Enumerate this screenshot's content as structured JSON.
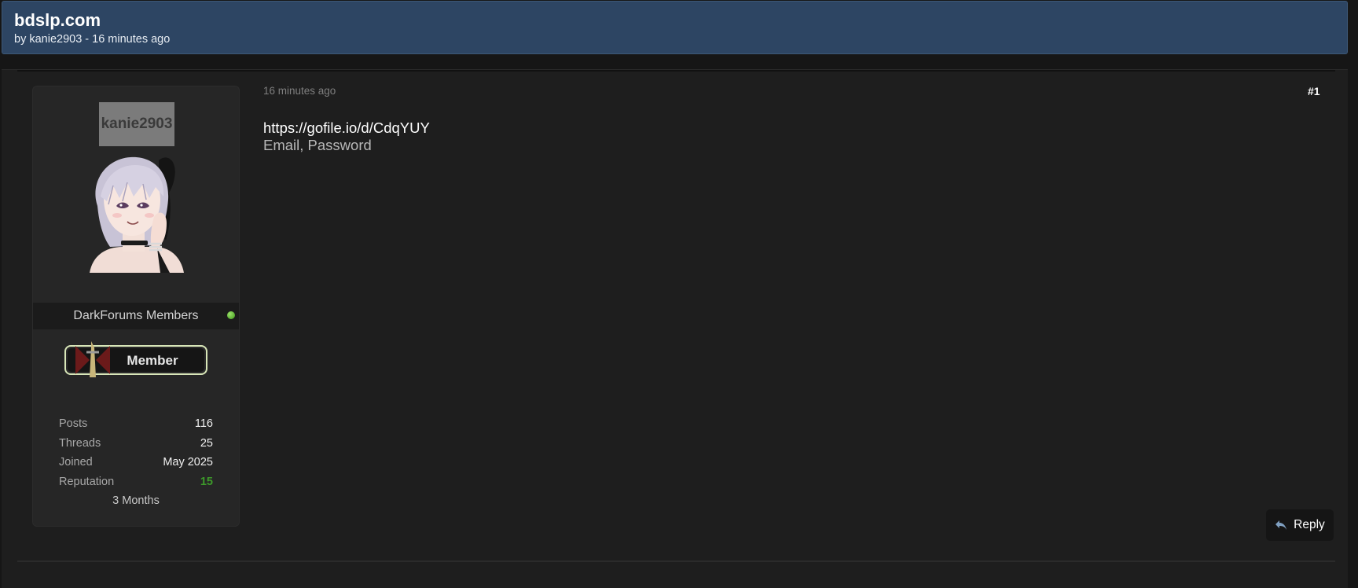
{
  "thread": {
    "title": "bdslp.com",
    "meta": "by kanie2903 - 16 minutes ago"
  },
  "user": {
    "name": "kanie2903",
    "group": "DarkForums Members",
    "rank_badge_text": "Member",
    "stats": [
      {
        "label": "Posts",
        "value": "116"
      },
      {
        "label": "Threads",
        "value": "25"
      },
      {
        "label": "Joined",
        "value": "May 2025"
      },
      {
        "label": "Reputation",
        "value": "15"
      }
    ],
    "duration": "3 Months",
    "online_color": "#5cc02c"
  },
  "post": {
    "time": "16 minutes ago",
    "number": "#1",
    "link": "https://gofile.io/d/CdqYUY",
    "line2": "Email, Password"
  },
  "actions": {
    "reply_label": "Reply",
    "reply_icon": "reply-arrow-icon"
  },
  "colors": {
    "header_bg": "#2d4563",
    "reputation": "#3d9a2a"
  }
}
